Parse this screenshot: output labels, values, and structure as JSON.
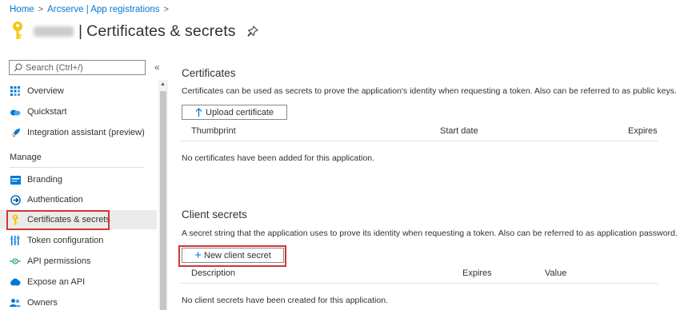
{
  "breadcrumb": [
    {
      "label": "Home"
    },
    {
      "label": "Arcserve | App registrations"
    }
  ],
  "breadcrumb_sep": ">",
  "title": {
    "separator": "|",
    "text": "Certificates & secrets"
  },
  "icons": {
    "title": "key-icon",
    "pin": "pin-icon",
    "search": "search-icon"
  },
  "sidebar": {
    "search_placeholder": "Search (Ctrl+/)",
    "collapse": "«",
    "items_top": [
      {
        "label": "Overview",
        "icon": "overview-grid-icon"
      },
      {
        "label": "Quickstart",
        "icon": "quickstart-cloud-icon"
      },
      {
        "label": "Integration assistant (preview)",
        "icon": "rocket-icon"
      }
    ],
    "section": "Manage",
    "items_manage": [
      {
        "label": "Branding",
        "icon": "branding-icon"
      },
      {
        "label": "Authentication",
        "icon": "authentication-icon"
      },
      {
        "label": "Certificates & secrets",
        "icon": "key-icon",
        "selected": true
      },
      {
        "label": "Token configuration",
        "icon": "token-bars-icon"
      },
      {
        "label": "API permissions",
        "icon": "api-permissions-icon"
      },
      {
        "label": "Expose an API",
        "icon": "cloud-icon"
      },
      {
        "label": "Owners",
        "icon": "owners-icon"
      }
    ]
  },
  "certificates": {
    "heading": "Certificates",
    "description": "Certificates can be used as secrets to prove the application's identity when requesting a token. Also can be referred to as public keys.",
    "upload_button": "Upload certificate",
    "columns": [
      "Thumbprint",
      "Start date",
      "Expires"
    ],
    "empty": "No certificates have been added for this application."
  },
  "client_secrets": {
    "heading": "Client secrets",
    "description": "A secret string that the application uses to prove its identity when requesting a token. Also can be referred to as application password.",
    "new_button": "New client secret",
    "columns": [
      "Description",
      "Expires",
      "Value"
    ],
    "empty": "No client secrets have been created for this application."
  },
  "colors": {
    "link": "#0078d4",
    "highlight": "#d13438",
    "key": "#f2c811",
    "selected_bg": "#edebe9"
  }
}
